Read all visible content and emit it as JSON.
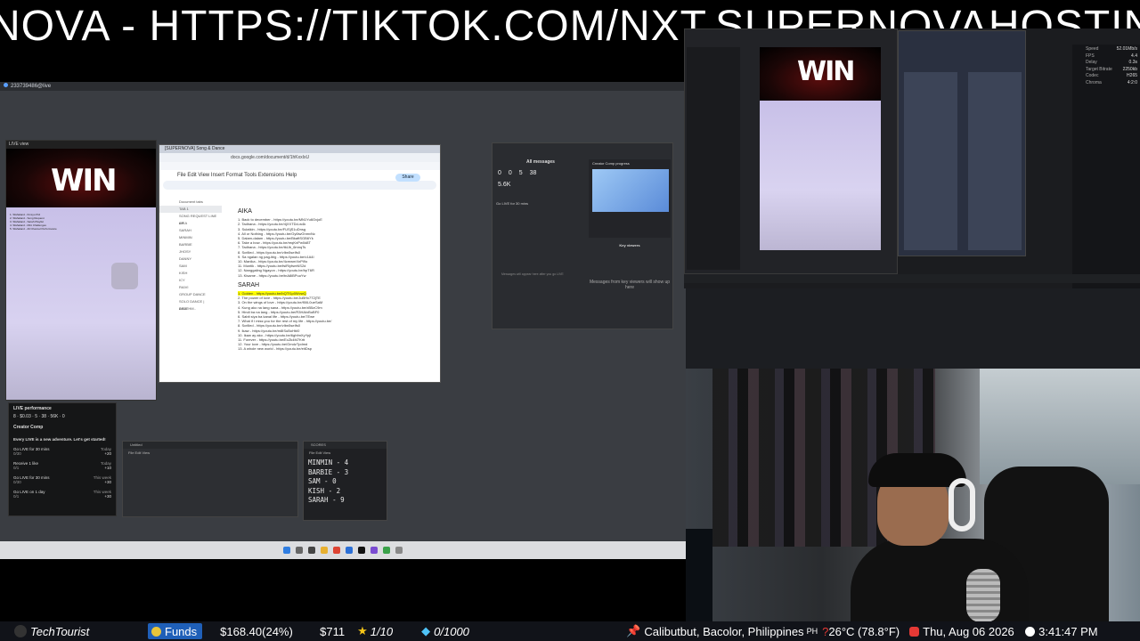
{
  "marquee": "NOVA - HTTPS://TIKTOK.COM/NXT.SUPERNOVAHOSTIN",
  "remote_bar": "233739486@live",
  "liveview": {
    "title": "LIVE view",
    "logo": "WIN",
    "list": [
      "1. Sfahaland - Kinsyo Pixl",
      "2. Sfahaland - Song Request",
      "3. Sfahaland - Sarah Playlist",
      "4. Sfahaland - Mini Challenges",
      "5. Sfahaland - All Channel Performance"
    ]
  },
  "docs": {
    "tab": "[SUPERNOVA] Song & Dance",
    "url": "docs.google.com/document/d/1hKxxIxU",
    "menu": "File   Edit   View   Insert   Format   Tools   Extensions   Help",
    "share": "Share",
    "sidebar": [
      "Document tabs",
      "TAB 1",
      "SONG REQUEST LINE UP",
      "AIKA",
      "SARAH",
      "MINMIN",
      "BARBIE",
      "JHOSY",
      "DANNY",
      "SAM",
      "KISH",
      "ICY",
      "RAIVI",
      "GROUP DANCE",
      "SOLO DANCE | DEATHM..",
      "AIKA"
    ],
    "section1": "AIKA",
    "aika": [
      "1. Back to december - https://youtu.be/MN1Yu6GvjoE",
      "2. Tadhana - https://youtu.be/4jXXTDd-w4k",
      "3. Sulatkin - https://youtu.be/FUSjS1uDnsg",
      "4. All or Nothing - https://youtu.be/Gy6iwGhmvNc",
      "5. Dalam-dalam - https://youtu.be/BkaftSGB6Yk",
      "6. Take a bow - https://youtu.be/reqKnPw0d8T",
      "7. Tadhana - https://youtu.be/tkUb_6mnqTs",
      "8. Scrilled - https://youtu.be/vIbn5seIfs0",
      "9. Sa ngalan ng pag-ibig - https://youtu.be/v1A4I",
      "10. Manika - https://youtu.be/4cmwmXnPi9o",
      "11. Muntik - https://youtu.be/fsiRiyfsmNS2d",
      "12. Nanggaling Ngayon - https://youtu.be/hpT6R",
      "13. Kisame - https://youtu.be/tnA8iBPuuYw"
    ],
    "section2": "SARAH",
    "sarah_first": "1. Golden - https://youtu.be/bQTf1p0WvwQ",
    "sarah": [
      "2. The power of love - https://youtu.be/JuBHx7T2jTE",
      "3. On the wings of love - https://youtu.be/f0iIL0ueSaM",
      "4. Kung ako na lang sana - https://youtu.be/xB5zC9m",
      "5. Hindi ba na lang - https://youtu.be/R3HAIxBuBF0",
      "6. Sabit siya ba kanal life - https://youtu.be/7Ewe",
      "7. What if I miss you for the rest of my life - https://youtu.be/",
      "8. Scrilled - https://youtu.be/vIbn5seIfs0",
      "9. Ikaw - https://youtu.be/m8ISuBoHbl0",
      "10. Ikaw ay ako - https://youtu.be/6ghfmXyYpjl",
      "11. Forever - https://youtu.be/EcZk4M7Krtt",
      "12. Your love - https://youtu.be/GmdzTpdmd",
      "13. A whole new world - https://youtu.be/eitDsp"
    ]
  },
  "messages": {
    "title": "All messages",
    "stats": [
      "0",
      "0",
      "5",
      "38"
    ],
    "likes": "5.6K",
    "golive": "Go LIVE for 30 mins",
    "creator_title": "Creator Comp progress",
    "key_viewers": "Key viewers",
    "key_text": "Messages from key viewers will show up here",
    "empty": "Messages will appear here after you go LIVE"
  },
  "performance": {
    "title": "LIVE performance",
    "values": [
      "8",
      "$0.03",
      "5",
      "38",
      "56K",
      "0"
    ],
    "creator_comp": "Creator Comp",
    "message": "Every LIVE is a new adventure. Let's get started!",
    "tasks": [
      {
        "label": "Go LIVE for 30 mins",
        "when": "Today",
        "progress": "0/30",
        "reward": "+20"
      },
      {
        "label": "Receive 1 like",
        "when": "Today",
        "progress": "0/1",
        "reward": "+10"
      },
      {
        "label": "Go LIVE for 30 mins",
        "when": "This week",
        "progress": "0/30",
        "reward": "+30"
      },
      {
        "label": "Go LIVE on 1 day",
        "when": "This week",
        "progress": "0/1",
        "reward": "+30"
      }
    ]
  },
  "notepad1": {
    "title": "Untitled",
    "menu": "File    Edit    View"
  },
  "notepad2": {
    "title": "SCORES",
    "menu": "File    Edit    View",
    "lines": [
      "MINMIN - 4",
      "BARBIE - 3",
      "SAM - 0",
      "KISH - 2",
      "SARAH - 9"
    ]
  },
  "obs_stats": [
    {
      "k": "Speed",
      "v": "52.01Mb/s"
    },
    {
      "k": "FPS",
      "v": "4.4"
    },
    {
      "k": "Delay",
      "v": "0.3s"
    },
    {
      "k": "Target Bitrate",
      "v": "2250kb"
    },
    {
      "k": "Codec",
      "v": "H265"
    },
    {
      "k": "Chroma",
      "v": "4:2:0"
    }
  ],
  "ticker": {
    "user": "TechTourist",
    "funds_label": "Funds",
    "funds_value": "$168.40(24%)",
    "amount": "$711",
    "stars": "1/10",
    "gems": "0/1000",
    "location": "Calibutbut, Bacolor, Philippines",
    "country": "PH",
    "weather": "26°C (78.8°F)",
    "date": "Thu, Aug 06 2026",
    "time": "3:41:47 PM"
  },
  "colors": {
    "accent": "#1f5fb8",
    "link": "#1155cc",
    "highlight": "#ffff00",
    "tiktok_red": "#fe2c55"
  }
}
